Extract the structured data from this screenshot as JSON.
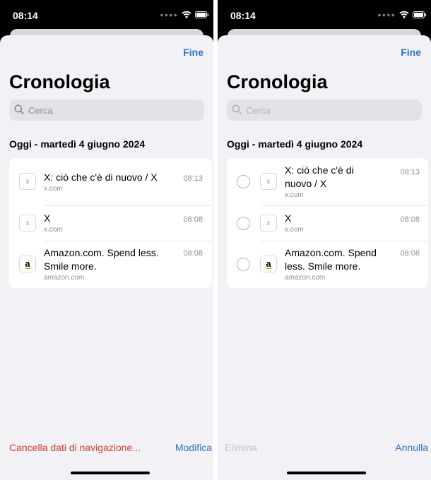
{
  "left_screen": {
    "status_bar": {
      "time": "08:14"
    },
    "done_label": "Fine",
    "title": "Cronologia",
    "search": {
      "placeholder": "Cerca"
    },
    "section_header": "Oggi - martedì 4 giugno 2024",
    "items": [
      {
        "title_lines": [
          "X: ciò che c'è di nuovo / X"
        ],
        "url": "x.com",
        "time": "08:13",
        "icon": "x-favicon-icon"
      },
      {
        "title_lines": [
          "X"
        ],
        "url": "x.com",
        "time": "08:08",
        "icon": "x-favicon-icon"
      },
      {
        "title_lines": [
          "Amazon.com. Spend less.",
          "Smile more."
        ],
        "url": "amazon.com",
        "time": "08:08",
        "icon": "amazon-favicon-icon"
      }
    ],
    "bottom": {
      "left_action": "Cancella dati di navigazione...",
      "right_action": "Modifica"
    }
  },
  "right_screen": {
    "status_bar": {
      "time": "08:14"
    },
    "done_label": "Fine",
    "title": "Cronologia",
    "search": {
      "placeholder": "Cerca"
    },
    "section_header": "Oggi - martedì 4 giugno 2024",
    "items": [
      {
        "title_lines": [
          "X: ciò che c'è di",
          "nuovo / X"
        ],
        "url": "x.com",
        "time": "08:13",
        "icon": "x-favicon-icon",
        "selected": false
      },
      {
        "title_lines": [
          "X"
        ],
        "url": "x.com",
        "time": "08:08",
        "icon": "x-favicon-icon",
        "selected": false
      },
      {
        "title_lines": [
          "Amazon.com. Spend",
          "less. Smile more."
        ],
        "url": "amazon.com",
        "time": "08:08",
        "icon": "amazon-favicon-icon",
        "selected": false
      }
    ],
    "bottom": {
      "left_action": "Elimina",
      "right_action": "Annulla"
    }
  },
  "colors": {
    "accent_blue": "#2b73c7",
    "destructive_red": "#d63a2e",
    "sheet_background": "#f2f2f6"
  },
  "icons": {
    "favicon_x_glyph": "x",
    "favicon_amazon_glyph": "a"
  }
}
